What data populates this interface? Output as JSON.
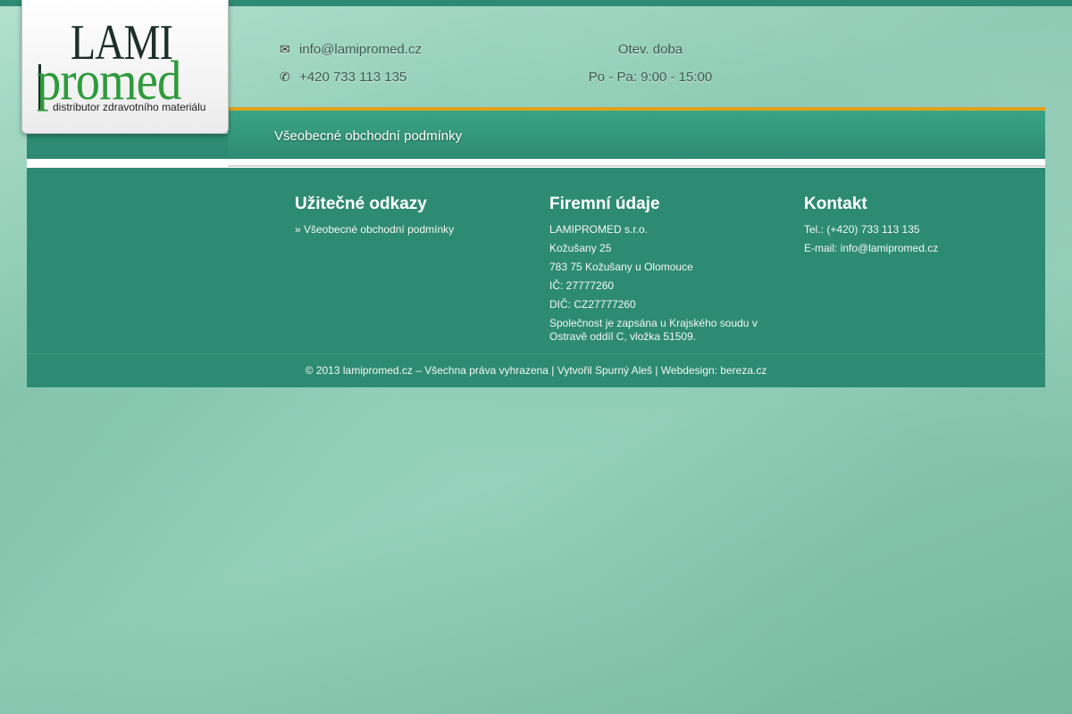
{
  "logo": {
    "line1": "LAMI",
    "line2": "promed",
    "tagline": "distributor zdravotního materiálu"
  },
  "header": {
    "email": "info@lamipromed.cz",
    "phone": "+420 733 113 135",
    "hours_label": "Otev. doba",
    "hours_value": "Po - Pa: 9:00 - 15:00",
    "icons": {
      "email": "envelope-icon",
      "phone": "phone-icon"
    }
  },
  "nav": {
    "items": [
      {
        "label": "Všeobecné obchodní podmínky"
      }
    ]
  },
  "footer": {
    "links": {
      "title": "Užitečné odkazy",
      "items": [
        "» Všeobecné obchodní podmínky"
      ]
    },
    "company": {
      "title": "Firemní údaje",
      "lines": [
        "LAMIPROMED s.r.o.",
        "Kožušany 25",
        "783 75 Kožušany u Olomouce",
        "IČ: 27777260",
        "DIČ: CZ27777260",
        "Společnost je zapsána u Krajského soudu v Ostravě oddíl C, vložka 51509."
      ]
    },
    "contact": {
      "title": "Kontakt",
      "lines": [
        "Tel.: (+420) 733 113 135",
        "E-mail: info@lamipromed.cz"
      ]
    },
    "copyright": "© 2013 lamipromed.cz – Všechna práva vyhrazena | Vytvořil Spurný Aleš | Webdesign: bereza.cz"
  },
  "colors": {
    "primary": "#2e8b73",
    "accent": "#e0a21c",
    "background": "#8fcfb8",
    "logo_green": "#2e9a3c"
  }
}
